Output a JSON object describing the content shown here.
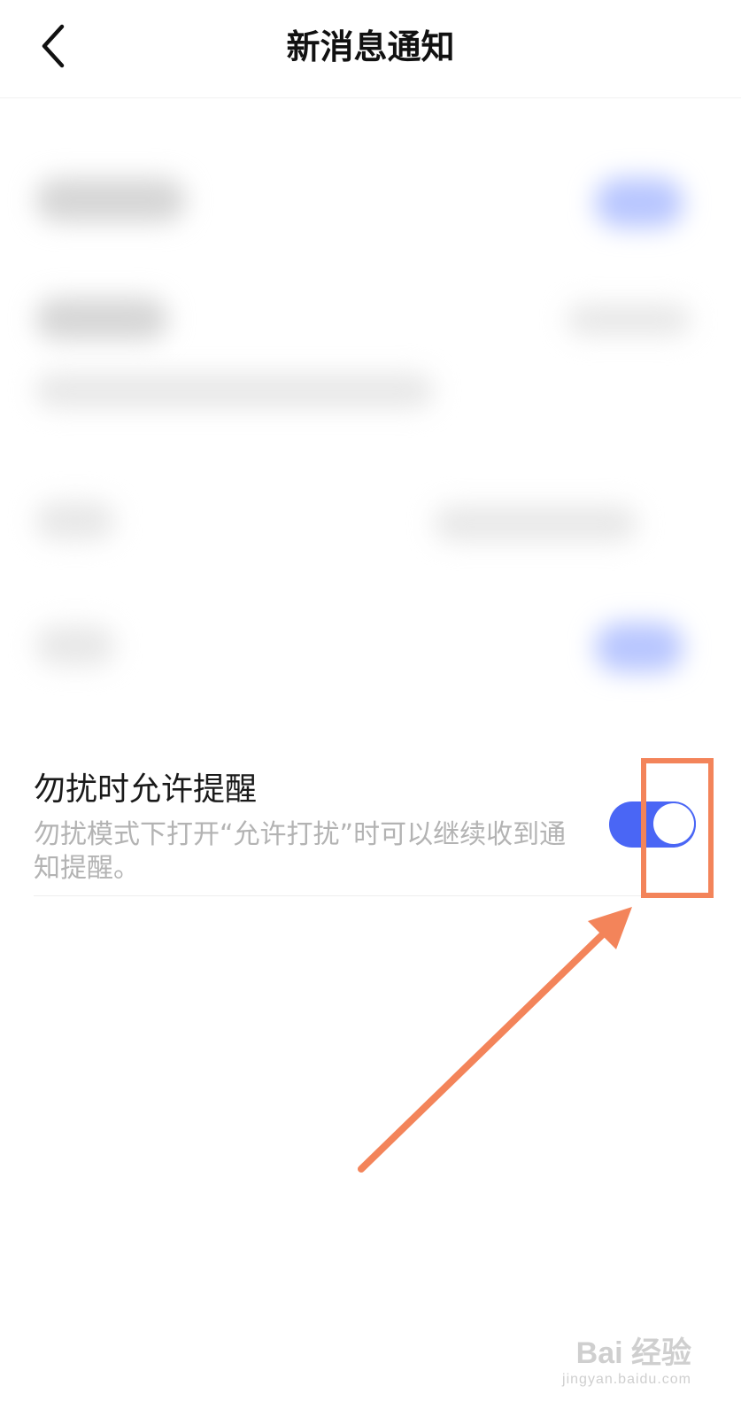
{
  "header": {
    "title": "新消息通知",
    "back_icon": "chevron-left-icon"
  },
  "dnd_setting": {
    "title": "勿扰时允许提醒",
    "description": "勿扰模式下打开“允许打扰”时可以继续收到通知提醒。",
    "toggle_on": true,
    "toggle_color": "#4a66f5"
  },
  "annotation": {
    "highlight_color": "#f3845a"
  },
  "watermark": {
    "logo": "Bai  经验",
    "site": "jingyan.baidu.com"
  }
}
